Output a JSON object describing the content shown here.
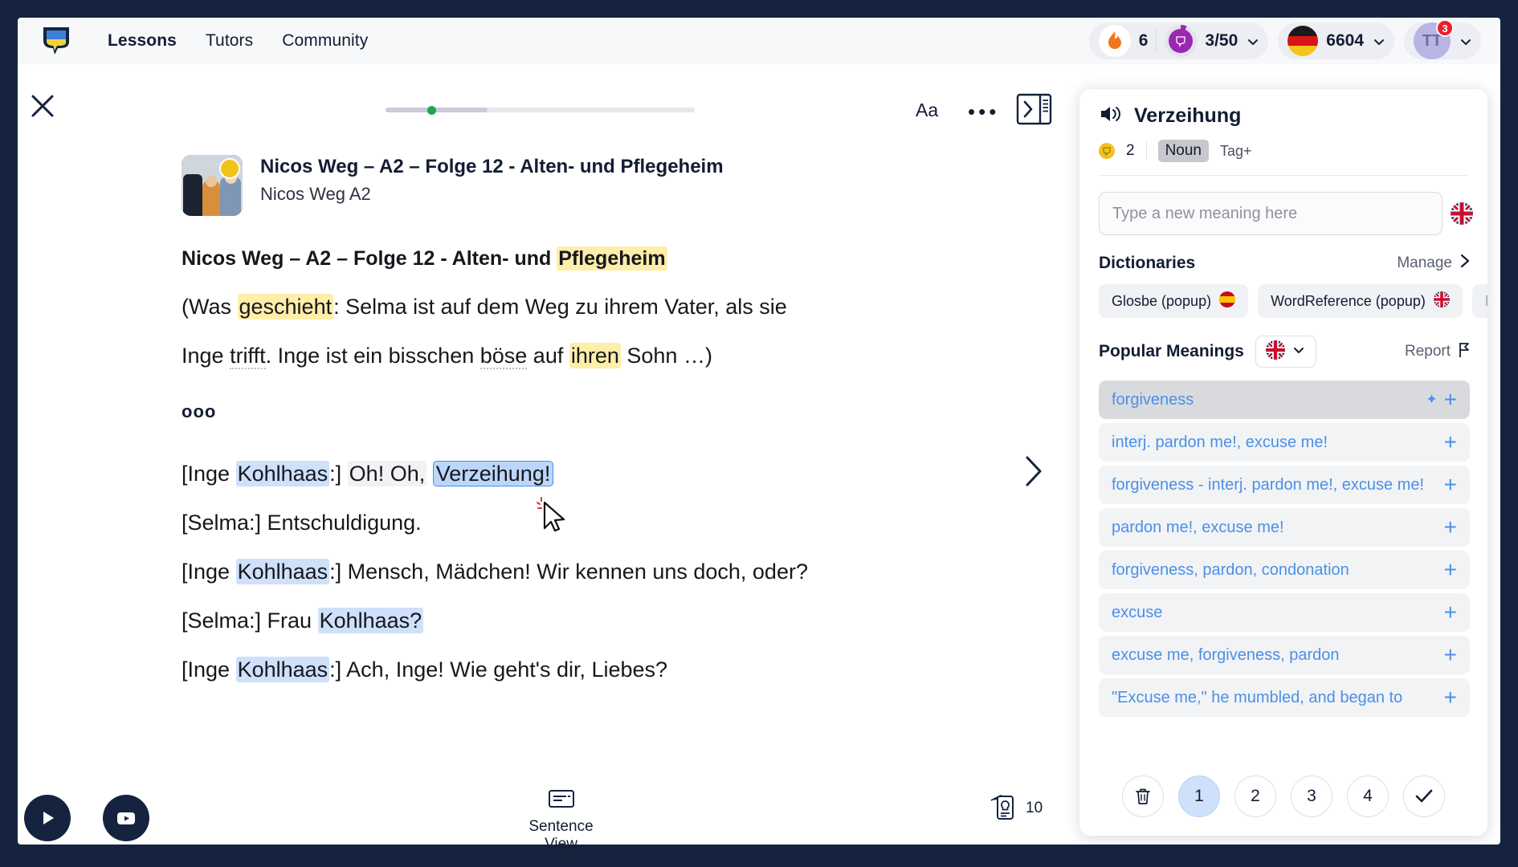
{
  "header": {
    "logo_icon": "lingq-logo-icon",
    "nav": [
      {
        "label": "Lessons",
        "active": true
      },
      {
        "label": "Tutors",
        "active": false
      },
      {
        "label": "Community",
        "active": false
      }
    ],
    "streak": {
      "icon": "flame-icon",
      "value": "6"
    },
    "goal": {
      "icon": "goal-ring-icon",
      "value": "3/50",
      "chevron": "chevron-down-icon"
    },
    "coins": {
      "flag": "german-flag-icon",
      "value": "6604",
      "chevron": "chevron-down-icon"
    },
    "avatar": {
      "initials": "TT",
      "badge": "3",
      "chevron": "chevron-down-icon"
    }
  },
  "toolbar": {
    "close_icon": "close-icon",
    "font_size_label": "Aa",
    "more_icon": "more-options-icon",
    "panel_toggle_icon": "toggle-sidebar-icon",
    "progress_percent": 33
  },
  "lesson": {
    "thumbnail": "lesson-thumbnail",
    "title": "Nicos Weg – A2 – Folge 12 - Alten- und Pflegeheim",
    "course": "Nicos Weg A2"
  },
  "content": {
    "heading_parts": [
      {
        "text": "Nicos Weg – A2 – Folge 12 - Alten- und ",
        "style": "plain"
      },
      {
        "text": "Pflegeheim",
        "style": "yellow"
      }
    ],
    "line2_parts": [
      {
        "text": "(Was ",
        "style": "plain"
      },
      {
        "text": "geschieht",
        "style": "yellow"
      },
      {
        "text": ": Selma ist auf dem Weg zu ihrem Vater, als sie",
        "style": "plain"
      }
    ],
    "line3_parts": [
      {
        "text": "Inge ",
        "style": "plain"
      },
      {
        "text": "trifft",
        "style": "dotted"
      },
      {
        "text": ". Inge ist ein bisschen ",
        "style": "plain"
      },
      {
        "text": "böse",
        "style": "dotted"
      },
      {
        "text": " auf ",
        "style": "plain"
      },
      {
        "text": "ihren",
        "style": "yellow"
      },
      {
        "text": " Sohn …)",
        "style": "plain"
      }
    ],
    "separator": "ooo",
    "dialogue": [
      [
        {
          "text": "[Inge ",
          "style": "plain"
        },
        {
          "text": "Kohlhaas",
          "style": "blue"
        },
        {
          "text": ":] ",
          "style": "plain"
        },
        {
          "text": "Oh! Oh,",
          "style": "grey"
        },
        {
          "text": " ",
          "style": "plain"
        },
        {
          "text": "Verzeihung!",
          "style": "selected"
        }
      ],
      [
        {
          "text": "[Selma:] Entschuldigung.",
          "style": "plain"
        }
      ],
      [
        {
          "text": "[Inge ",
          "style": "plain"
        },
        {
          "text": "Kohlhaas",
          "style": "blue"
        },
        {
          "text": ":] Mensch, Mädchen! Wir kennen uns doch, oder?",
          "style": "plain"
        }
      ],
      [
        {
          "text": "[Selma:] Frau ",
          "style": "plain"
        },
        {
          "text": "Kohlhaas?",
          "style": "blue"
        }
      ],
      [
        {
          "text": "[Inge ",
          "style": "plain"
        },
        {
          "text": "Kohlhaas",
          "style": "blue"
        },
        {
          "text": ":] Ach, Inge! Wie geht's dir, Liebes?",
          "style": "plain"
        }
      ]
    ],
    "next_icon": "chevron-right-icon",
    "cursor_icon": "mouse-cursor-icon"
  },
  "footer": {
    "play_icon": "play-icon",
    "youtube_icon": "youtube-icon",
    "sentence_view": {
      "icon": "sentence-view-icon",
      "label": "Sentence View"
    },
    "cards": {
      "icon": "flashcards-icon",
      "count": "10"
    }
  },
  "panel": {
    "audio_icon": "speaker-icon",
    "word": "Verzeihung",
    "coin_icon": "coin-icon",
    "coin_value": "2",
    "pos_tag": "Noun",
    "tag_add": "Tag+",
    "new_meaning_placeholder": "Type a new meaning here",
    "input_flag": "uk-flag-icon",
    "dictionaries": {
      "title": "Dictionaries",
      "manage_label": "Manage",
      "manage_icon": "chevron-right-icon",
      "chips": [
        {
          "label": "Glosbe (popup)",
          "flag": "spain-flag-icon"
        },
        {
          "label": "WordReference (popup)",
          "flag": "uk-flag-icon"
        },
        {
          "label": "Ma",
          "flag": "none"
        }
      ]
    },
    "popular": {
      "title": "Popular Meanings",
      "lang_flag": "uk-flag-icon",
      "lang_chevron": "chevron-down-icon",
      "report_label": "Report",
      "report_icon": "flag-icon"
    },
    "meanings": [
      {
        "text": "forgiveness",
        "selected": true,
        "sparkle": true
      },
      {
        "text": "interj. pardon me!, excuse me!",
        "selected": false,
        "sparkle": false
      },
      {
        "text": "forgiveness - interj. pardon me!, excuse me!",
        "selected": false,
        "sparkle": false
      },
      {
        "text": "pardon me!, excuse me!",
        "selected": false,
        "sparkle": false
      },
      {
        "text": "forgiveness, pardon, condonation",
        "selected": false,
        "sparkle": false
      },
      {
        "text": "excuse",
        "selected": false,
        "sparkle": false
      },
      {
        "text": "excuse me, forgiveness, pardon",
        "selected": false,
        "sparkle": false
      },
      {
        "text": "\"Excuse me,\" he mumbled, and began to",
        "selected": false,
        "sparkle": false
      }
    ],
    "status_buttons": [
      {
        "label": "",
        "icon": "trash-icon",
        "active": false
      },
      {
        "label": "1",
        "icon": "",
        "active": true
      },
      {
        "label": "2",
        "icon": "",
        "active": false
      },
      {
        "label": "3",
        "icon": "",
        "active": false
      },
      {
        "label": "4",
        "icon": "",
        "active": false
      },
      {
        "label": "",
        "icon": "check-icon",
        "active": false
      }
    ]
  }
}
